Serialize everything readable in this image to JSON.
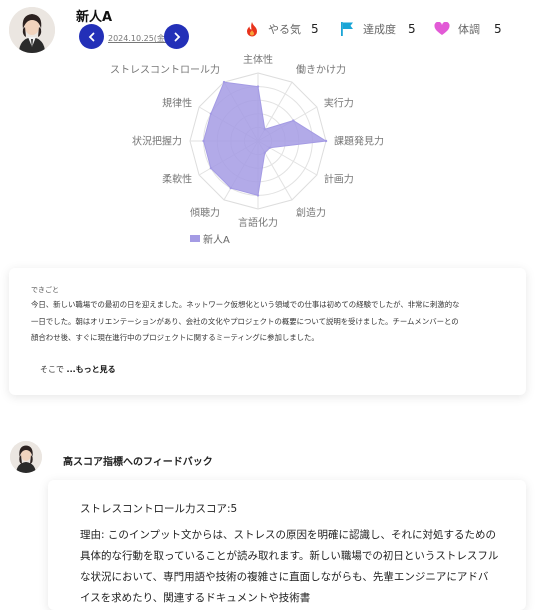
{
  "header": {
    "user_name": "新人A",
    "date": "2024.10.25(金)"
  },
  "metrics": [
    {
      "icon": "fire-icon",
      "label": "やる気",
      "value": "5",
      "color": "#e8331c"
    },
    {
      "icon": "flag-icon",
      "label": "達成度",
      "value": "5",
      "color": "#1aa5d6"
    },
    {
      "icon": "heart-icon",
      "label": "体調",
      "value": "5",
      "color": "#e25ad6"
    }
  ],
  "chart_data": {
    "type": "radar",
    "axes": [
      "主体性",
      "働きかけ力",
      "実行力",
      "課題発見力",
      "計画力",
      "創造力",
      "言語化力",
      "傾聴力",
      "柔軟性",
      "状況把握力",
      "規律性",
      "ストレスコントロール力"
    ],
    "series": [
      {
        "name": "新人A",
        "values": [
          4,
          1,
          3,
          5,
          1,
          1,
          4,
          4,
          4,
          4,
          4,
          5
        ],
        "color": "#a49be4"
      }
    ],
    "rmax": 5,
    "levels": 5,
    "legend": "bottom"
  },
  "event": {
    "label": "できごと",
    "lines": [
      "今日、新しい職場での最初の日を迎えました。ネットワーク仮想化という領域での仕事は初めての経験でしたが、非常に刺激的な",
      "一日でした。朝はオリエンテーションがあり、会社の文化やプロジェクトの概要について説明を受けました。チームメンバーとの",
      "顔合わせ後、すぐに現在進行中のプロジェクトに関するミーティングに参加しました。"
    ],
    "more_prefix": "そこで",
    "more_link": "...もっと見る"
  },
  "feedback": {
    "title": "高スコア指標へのフィードバック",
    "score_line": "ストレスコントロール力スコア:5",
    "lines": [
      "理由: このインプット文からは、ストレスの原因を明確に認識し、それに対処するための",
      "具体的な行動を取っていることが読み取れます。新しい職場での初日というストレスフル",
      "な状況において、専門用語や技術の複雑さに直面しながらも、先輩エンジニアにアドバ",
      "イスを求めたり、関連するドキュメントや技術書"
    ]
  }
}
